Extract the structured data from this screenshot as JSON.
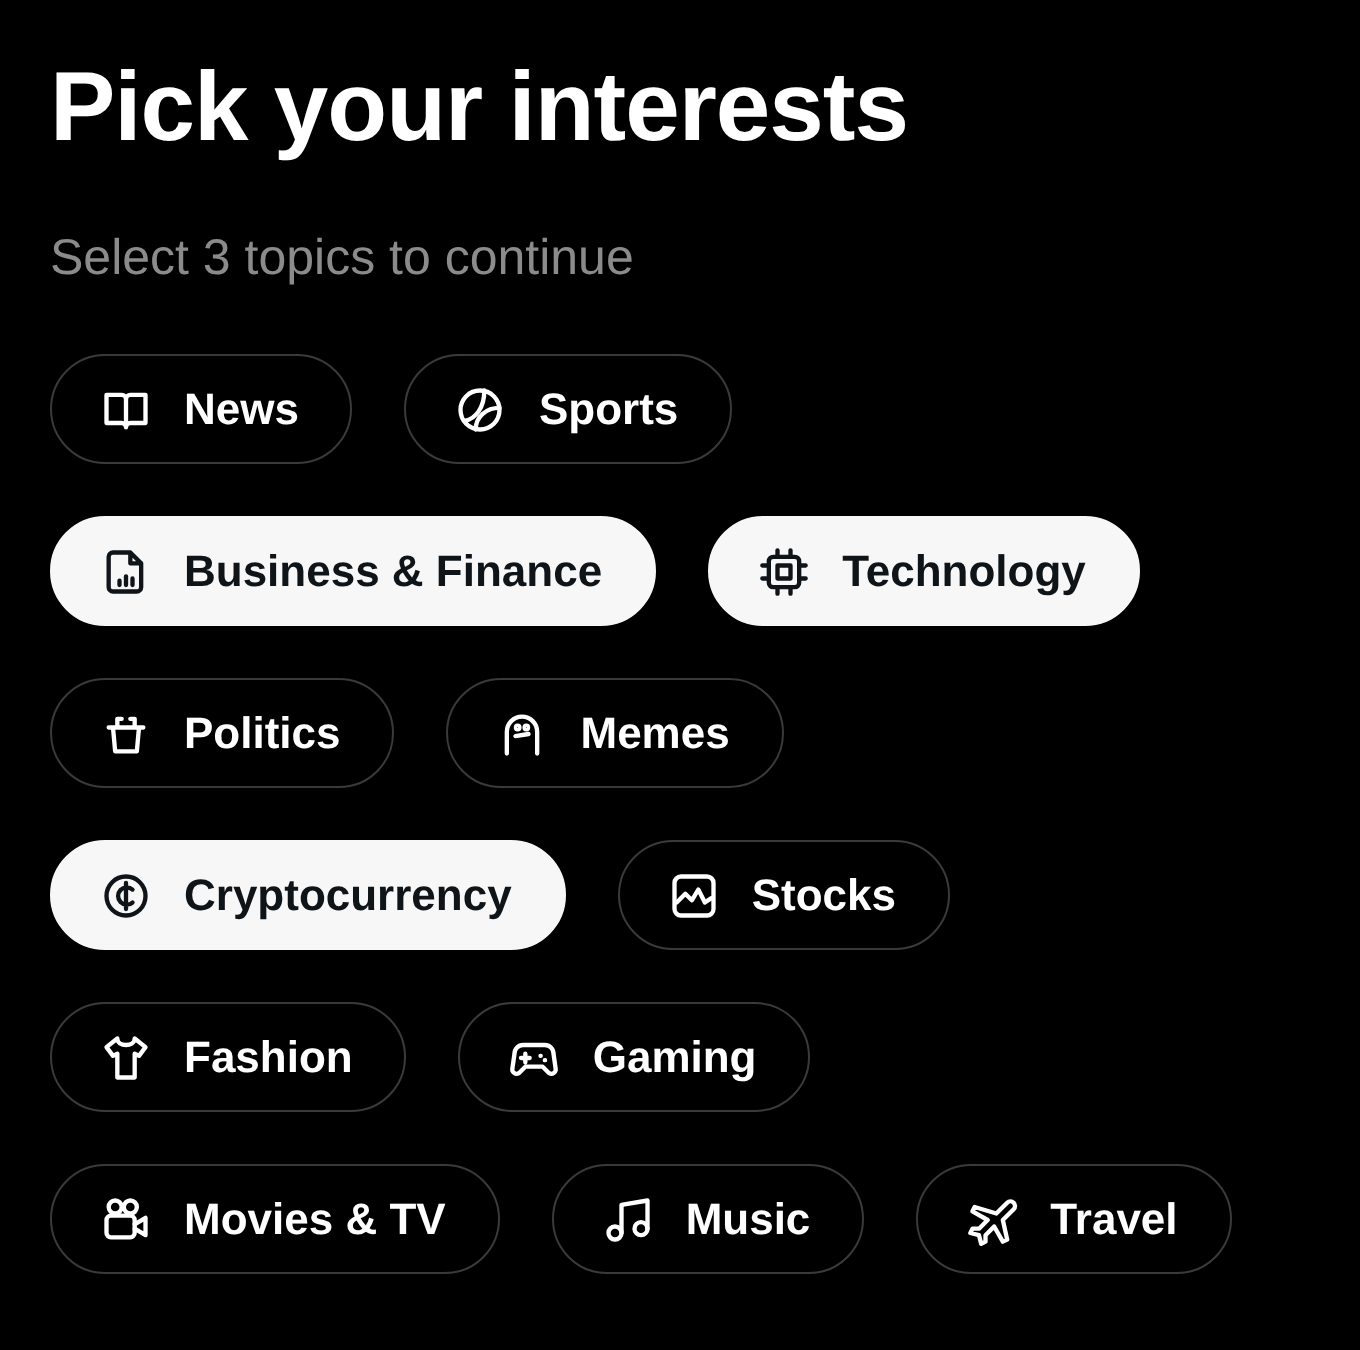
{
  "title": "Pick your interests",
  "subtitle": "Select 3 topics to continue",
  "topic_rows": [
    [
      {
        "label": "News",
        "kind": "book",
        "selected": false
      },
      {
        "label": "Sports",
        "kind": "ball",
        "selected": false
      }
    ],
    [
      {
        "label": "Business & Finance",
        "kind": "report",
        "selected": true
      },
      {
        "label": "Technology",
        "kind": "chip",
        "selected": true
      }
    ],
    [
      {
        "label": "Politics",
        "kind": "podium",
        "selected": false
      },
      {
        "label": "Memes",
        "kind": "meme",
        "selected": false
      }
    ],
    [
      {
        "label": "Cryptocurrency",
        "kind": "coin",
        "selected": true
      },
      {
        "label": "Stocks",
        "kind": "chart",
        "selected": false
      }
    ],
    [
      {
        "label": "Fashion",
        "kind": "shirt",
        "selected": false
      },
      {
        "label": "Gaming",
        "kind": "gamepad",
        "selected": false
      }
    ],
    [
      {
        "label": "Movies & TV",
        "kind": "camera",
        "selected": false
      },
      {
        "label": "Music",
        "kind": "note",
        "selected": false
      },
      {
        "label": "Travel",
        "kind": "plane",
        "selected": false
      }
    ]
  ]
}
